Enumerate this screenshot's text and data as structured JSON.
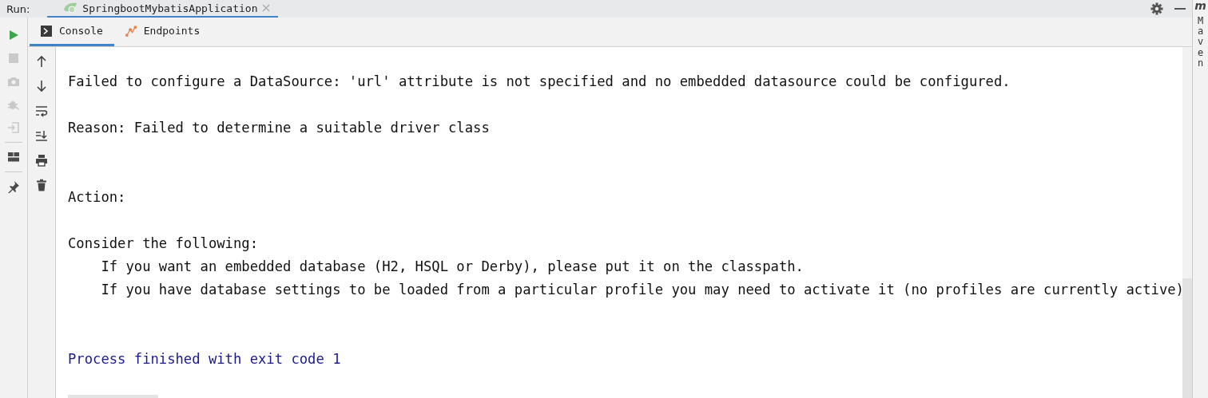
{
  "run_bar": {
    "label": "Run:",
    "tabs": [
      {
        "label": "SpringbootMybatisApplication",
        "selected": true
      }
    ]
  },
  "side_panel": {
    "logo": "m",
    "label": "Maven"
  },
  "tabs": [
    {
      "label": "Console",
      "kind": "console",
      "selected": true
    },
    {
      "label": "Endpoints",
      "kind": "endpoints",
      "selected": false
    }
  ],
  "console": {
    "lines": [
      {
        "kind": "blank"
      },
      {
        "kind": "text",
        "text": "Failed to configure a DataSource: 'url' attribute is not specified and no embedded datasource could be configured."
      },
      {
        "kind": "blank"
      },
      {
        "kind": "text",
        "text": "Reason: Failed to determine a suitable driver class"
      },
      {
        "kind": "blank"
      },
      {
        "kind": "blank"
      },
      {
        "kind": "text",
        "text": "Action:"
      },
      {
        "kind": "blank"
      },
      {
        "kind": "text",
        "text": "Consider the following:"
      },
      {
        "kind": "text",
        "text": "    If you want an embedded database (H2, HSQL or Derby), please put it on the classpath."
      },
      {
        "kind": "text",
        "text": "    If you have database settings to be loaded from a particular profile you may need to activate it (no profiles are currently active)"
      },
      {
        "kind": "blank"
      },
      {
        "kind": "blank"
      },
      {
        "kind": "exit",
        "text": "Process finished with exit code 1"
      }
    ]
  }
}
